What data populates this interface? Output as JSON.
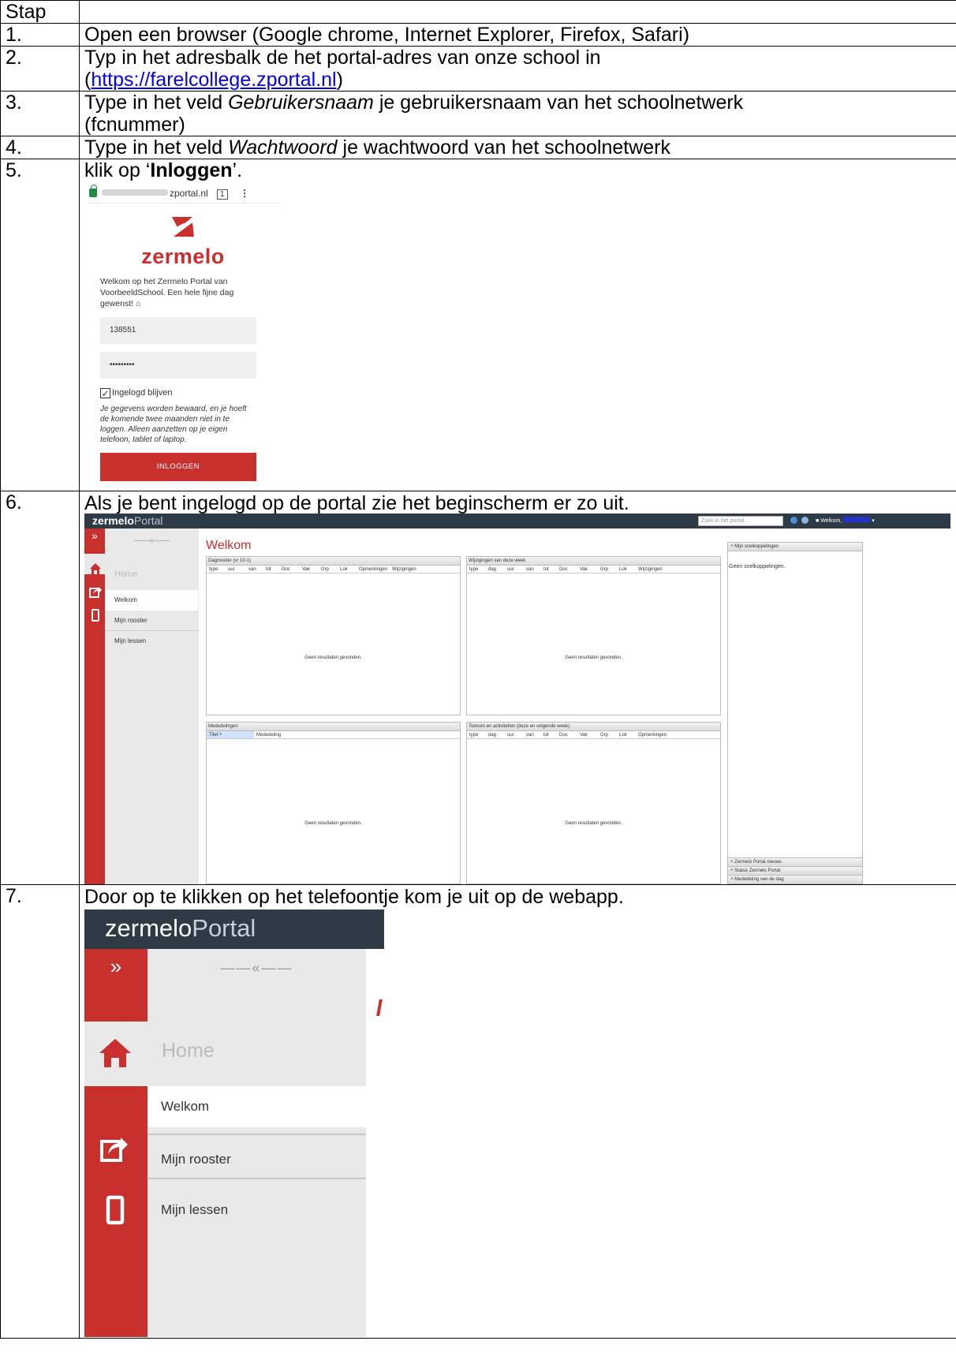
{
  "table": {
    "header_step": "Stap",
    "header_desc": ""
  },
  "steps": [
    {
      "num": "1.",
      "text": "Open een browser (Google chrome, Internet Explorer, Firefox, Safari)"
    },
    {
      "num": "2.",
      "text_before": "Typ in het adresbalk de het portal-adres van onze school in",
      "paren_open": "(",
      "link": "https://farelcollege.zportal.nl",
      "paren_close": ")"
    },
    {
      "num": "3.",
      "text_before": "Type in het veld ",
      "emph": "Gebruikersnaam",
      "text_after": " je gebruikersnaam van het schoolnetwerk",
      "line2": "(fcnummer)"
    },
    {
      "num": "4.",
      "text_before": "Type in het veld ",
      "emph": "Wachtwoord",
      "text_after": " je wachtwoord van het schoolnetwerk"
    },
    {
      "num": "5.",
      "text_before": "klik op ‘",
      "bold": "Inloggen",
      "text_after": "’."
    },
    {
      "num": "6.",
      "text": "Als je bent ingelogd op de portal zie het beginscherm er zo uit."
    },
    {
      "num": "7.",
      "text": "Door op te klikken op het telefoontje kom je uit op de webapp."
    }
  ],
  "login": {
    "url_suffix": "zportal.nl",
    "tab_count": "1",
    "menu": "⋮",
    "logo_text": "zermelo",
    "welcome": "Welkom op het Zermelo Portal van VoorbeeldSchool. Een hele fijne dag gewenst! ⌂",
    "username": "138551",
    "password": "•••••••••",
    "checkbox_mark": "✓",
    "remember_label": "Ingelogd blijven",
    "note": "Je gegevens worden bewaard, en je hoeft de komende twee maanden niet in te loggen. Alleen aanzetten op je eigen telefoon, tablet of laptop.",
    "button": "INLOGGEN"
  },
  "portal": {
    "brand_bold": "zermelo",
    "brand_rest": "Portal",
    "search_placeholder": "Zoek in het portal...",
    "welcome_user": "Welkom,",
    "nav_expand": "»",
    "nav_collapse": "——«——",
    "nav_home": "Home",
    "nav_items": [
      "Welkom",
      "Mijn rooster",
      "Mijn lessen"
    ],
    "page_title": "Welkom",
    "panels": {
      "dagrooster": {
        "title": "Dagrooster (vr 10-1)",
        "cols": [
          "type",
          "uur",
          "van",
          "tot",
          "Doc",
          "Vak",
          "Grp",
          "Lok",
          "Opmerkingen",
          "Wijzigingen"
        ]
      },
      "wijzigingen": {
        "title": "Wijzigingen van deze week",
        "cols": [
          "type",
          "dag",
          "uur",
          "van",
          "tot",
          "Doc",
          "Vak",
          "Grp",
          "Lok",
          "Wijzigingen"
        ]
      },
      "mededelingen": {
        "title": "Mededelingen",
        "cols": [
          "Titel ˄",
          "Mededeling"
        ]
      },
      "toetsen": {
        "title": "Toetsen en activiteiten (deze en volgende week)",
        "cols": [
          "type",
          "dag",
          "uur",
          "van",
          "tot",
          "Doc",
          "Vak",
          "Grp",
          "Lok",
          "Opmerkingen"
        ]
      }
    },
    "empty_text": "Geen resultaten gevonden.",
    "side": {
      "title": "˅  Mijn snelkoppelingen",
      "empty": "Geen snelkoppelingen.",
      "footers": [
        "˄  Zermelo Portal nieuws",
        "˄  Status Zermelo Portal",
        "˄  Mededeling van de dag"
      ]
    }
  },
  "zoom": {
    "brand_bold": "zermelo",
    "brand_rest": "Portal",
    "nav_expand": "»",
    "nav_collapse": "——«——",
    "home": "Home",
    "items": [
      "Welkom",
      "Mijn rooster",
      "Mijn lessen"
    ]
  },
  "colors": {
    "brand_red": "#c8302e",
    "topbar": "#2e3a45",
    "nav_bg": "#e9e9e9",
    "link": "#0000ee"
  }
}
